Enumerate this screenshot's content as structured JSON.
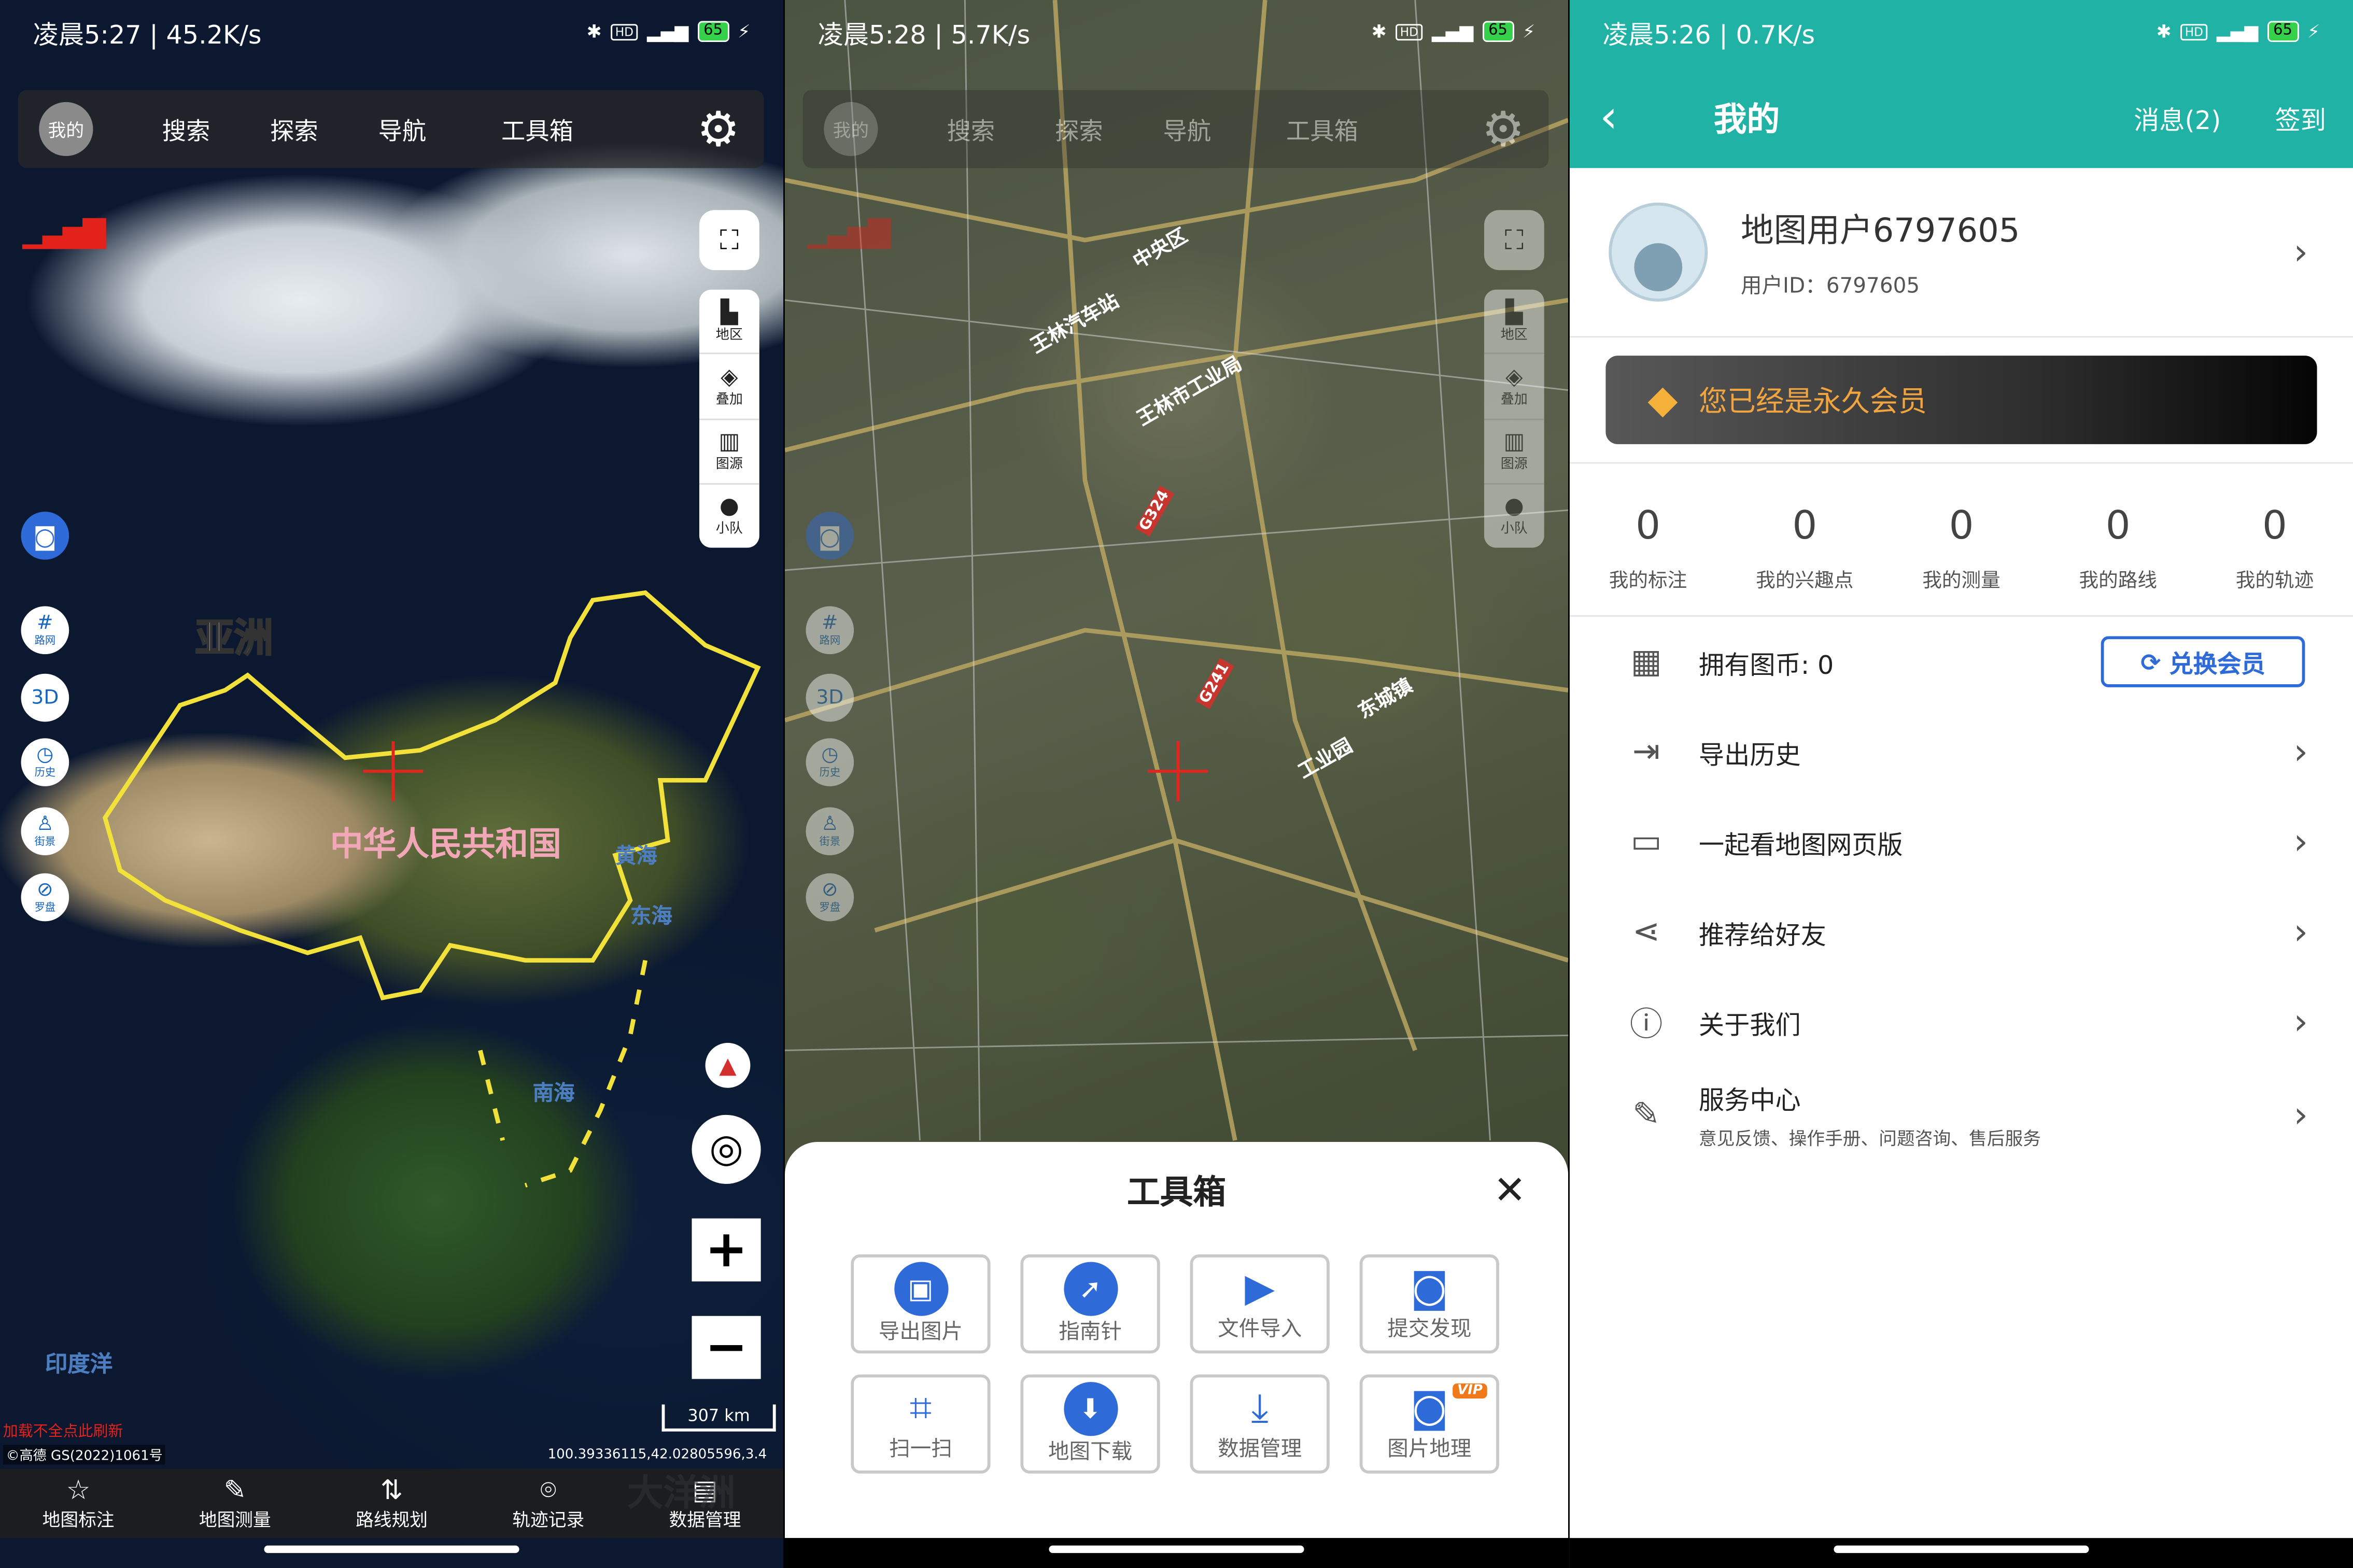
{
  "status_bars": [
    {
      "time": "凌晨5:27 | 45.2K/s",
      "battery": "65"
    },
    {
      "time": "凌晨5:28 | 5.7K/s",
      "battery": "65"
    },
    {
      "time": "凌晨5:26 | 0.7K/s",
      "battery": "65"
    }
  ],
  "map_nav": {
    "avatar": "我的",
    "items": [
      "搜索",
      "探索",
      "导航",
      "工具箱"
    ]
  },
  "right_tools": [
    "地区",
    "叠加",
    "图源",
    "小队"
  ],
  "left_tools": [
    "路网",
    "3D",
    "历史",
    "街景",
    "罗盘"
  ],
  "map1_labels": {
    "asia": "亚洲",
    "china": "中华人民共和国",
    "yellow_sea": "黄海",
    "east_sea": "东海",
    "south_sea": "南海",
    "indian_ocean": "印度洋",
    "oceania": "大洋洲"
  },
  "map_info": {
    "scale": "307 km",
    "reload": "加载不全点此刷新",
    "copyright": "©高德 GS(2022)1061号",
    "coords": "100.39336115,42.02805596,3.4"
  },
  "bottom_bar": [
    "地图标注",
    "地图测量",
    "路线规划",
    "轨迹记录",
    "数据管理"
  ],
  "map2_labels": [
    "王林市工业局",
    "王林汽车站",
    "G324",
    "G241",
    "中央区",
    "东城镇",
    "工业园"
  ],
  "toolbox": {
    "title": "工具箱",
    "items": [
      "导出图片",
      "指南针",
      "文件导入",
      "提交发现",
      "扫一扫",
      "地图下载",
      "数据管理",
      "图片地理"
    ],
    "vip_badge": "VIP"
  },
  "profile": {
    "title": "我的",
    "messages": "消息(2)",
    "sign_in": "签到",
    "username": "地图用户6797605",
    "user_id": "用户ID：6797605",
    "vip_text": "您已经是永久会员",
    "stats": [
      {
        "value": "0",
        "label": "我的标注"
      },
      {
        "value": "0",
        "label": "我的兴趣点"
      },
      {
        "value": "0",
        "label": "我的测量"
      },
      {
        "value": "0",
        "label": "我的路线"
      },
      {
        "value": "0",
        "label": "我的轨迹"
      }
    ],
    "coins": "拥有图币: 0",
    "exchange": "兑换会员",
    "menu": [
      "导出历史",
      "一起看地图网页版",
      "推荐给好友",
      "关于我们"
    ],
    "service": {
      "title": "服务中心",
      "subtitle": "意见反馈、操作手册、问题咨询、售后服务"
    }
  },
  "colors": {
    "header_teal": "#20b2a4",
    "accent_blue": "#2f6bd8",
    "china_border": "#f2e13a",
    "vip_gold": "#f0a540"
  }
}
